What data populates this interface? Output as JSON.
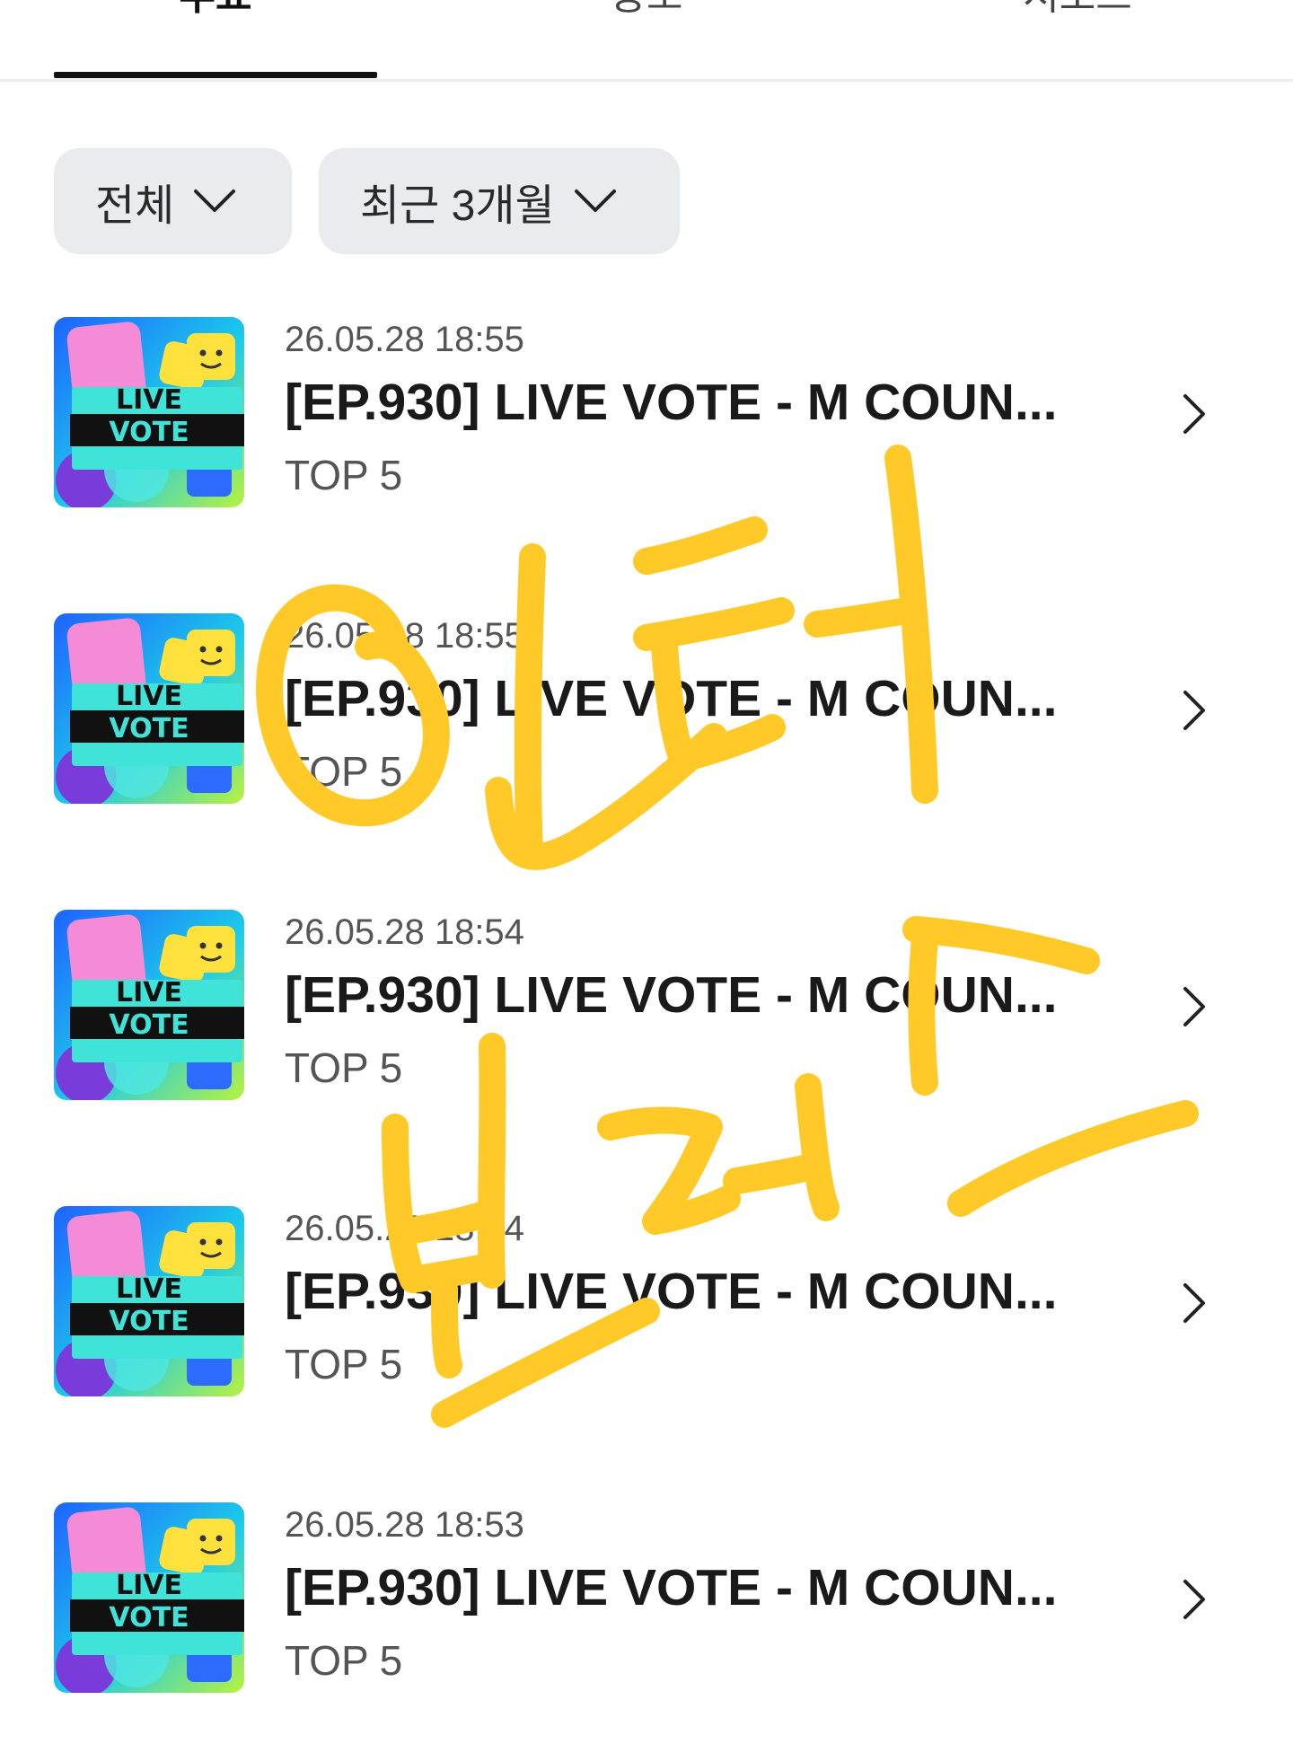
{
  "tabs": [
    {
      "label": "투표"
    },
    {
      "label": "응모"
    },
    {
      "label": "서포트"
    }
  ],
  "filters": [
    {
      "label": "전체"
    },
    {
      "label": "최근 3개월"
    }
  ],
  "items": [
    {
      "date": "26.05.28 18:55",
      "title": "[EP.930] LIVE VOTE - M COUN...",
      "subtitle": "TOP 5",
      "thumb_line1": "LIVE",
      "thumb_line2": "VOTE"
    },
    {
      "date": "26.05.28 18:55",
      "title": "[EP.930] LIVE VOTE - M COUN...",
      "subtitle": "TOP 5",
      "thumb_line1": "LIVE",
      "thumb_line2": "VOTE"
    },
    {
      "date": "26.05.28 18:54",
      "title": "[EP.930] LIVE VOTE - M COUN...",
      "subtitle": "TOP 5",
      "thumb_line1": "LIVE",
      "thumb_line2": "VOTE"
    },
    {
      "date": "26.05.28 18:54",
      "title": "[EP.930] LIVE VOTE - M COUN...",
      "subtitle": "TOP 5",
      "thumb_line1": "LIVE",
      "thumb_line2": "VOTE"
    },
    {
      "date": "26.05.28 18:53",
      "title": "[EP.930] LIVE VOTE - M COUN...",
      "subtitle": "TOP 5",
      "thumb_line1": "LIVE",
      "thumb_line2": "VOTE"
    }
  ],
  "annotation": {
    "text": "인터 보려고",
    "color": "#FFC928"
  },
  "colors": {
    "filter_bg": "#E9EBEF",
    "tab_active": "#111111",
    "thumb_teal": "#3FE3D8",
    "thumb_pink": "#F58BD6",
    "thumb_yellow": "#FFE13D",
    "thumb_blue": "#2D6BFF"
  }
}
